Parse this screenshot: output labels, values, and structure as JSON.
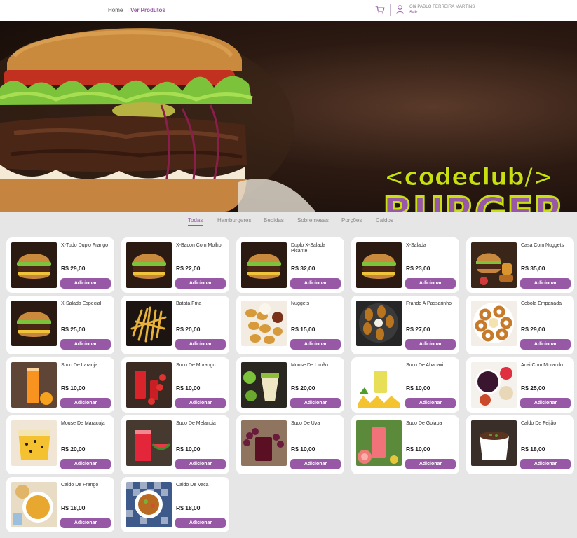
{
  "header": {
    "nav_home": "Home",
    "nav_products": "Ver Produtos",
    "greeting": "Olá PABLO FERREIRA MARTINS",
    "logout": "Sair",
    "cart_icon": "shopping-cart-icon",
    "user_icon": "user-icon"
  },
  "hero": {
    "logo_top": "<codeclub/>",
    "logo_bottom": "BURGER",
    "colors": {
      "lime": "#c8e10e",
      "purple": "#9758a6",
      "dark": "#221610"
    }
  },
  "tabs": [
    "Todas",
    "Hamburgeres",
    "Bebidas",
    "Sobremesas",
    "Porções",
    "Caldos"
  ],
  "active_tab": "Todas",
  "add_label": "Adicionar",
  "products": [
    {
      "name": "X-Tudo Duplo Frango",
      "price": "R$ 29,00",
      "thumb": "burger"
    },
    {
      "name": "X-Bacon Com Molho",
      "price": "R$ 22,00",
      "thumb": "burger"
    },
    {
      "name": "Duplo X-Salada Picante",
      "price": "R$ 32,00",
      "thumb": "burger"
    },
    {
      "name": "X-Salada",
      "price": "R$ 23,00",
      "thumb": "burger"
    },
    {
      "name": "Casa Com Nuggets",
      "price": "R$ 35,00",
      "thumb": "combo"
    },
    {
      "name": "X-Salada Especial",
      "price": "R$ 25,00",
      "thumb": "burger"
    },
    {
      "name": "Batata Frita",
      "price": "R$ 20,00",
      "thumb": "fries"
    },
    {
      "name": "Nuggets",
      "price": "R$ 15,00",
      "thumb": "nuggets"
    },
    {
      "name": "Frando A Passarinho",
      "price": "R$ 27,00",
      "thumb": "chicken"
    },
    {
      "name": "Cebola Empanada",
      "price": "R$ 29,00",
      "thumb": "onion"
    },
    {
      "name": "Suco De Laranja",
      "price": "R$ 10,00",
      "thumb": "orange-juice"
    },
    {
      "name": "Suco De Morango",
      "price": "R$ 10,00",
      "thumb": "red-juice"
    },
    {
      "name": "Mouse De Limão",
      "price": "R$ 20,00",
      "thumb": "lime-mousse"
    },
    {
      "name": "Suco De Abacaxi",
      "price": "R$ 10,00",
      "thumb": "pineapple-juice"
    },
    {
      "name": "Acai Com Morando",
      "price": "R$ 25,00",
      "thumb": "acai"
    },
    {
      "name": "Mouse De Maracuja",
      "price": "R$ 20,00",
      "thumb": "passion-mousse"
    },
    {
      "name": "Suco De Melancia",
      "price": "R$ 10,00",
      "thumb": "watermelon-juice"
    },
    {
      "name": "Suco De Uva",
      "price": "R$ 10,00",
      "thumb": "grape-juice"
    },
    {
      "name": "Suco De Goiaba",
      "price": "R$ 10,00",
      "thumb": "guava-juice"
    },
    {
      "name": "Caldo De Feijão",
      "price": "R$ 18,00",
      "thumb": "bean-soup"
    },
    {
      "name": "Caldo De Frango",
      "price": "R$ 18,00",
      "thumb": "chicken-soup"
    },
    {
      "name": "Caldo De Vaca",
      "price": "R$ 18,00",
      "thumb": "beef-soup"
    }
  ]
}
